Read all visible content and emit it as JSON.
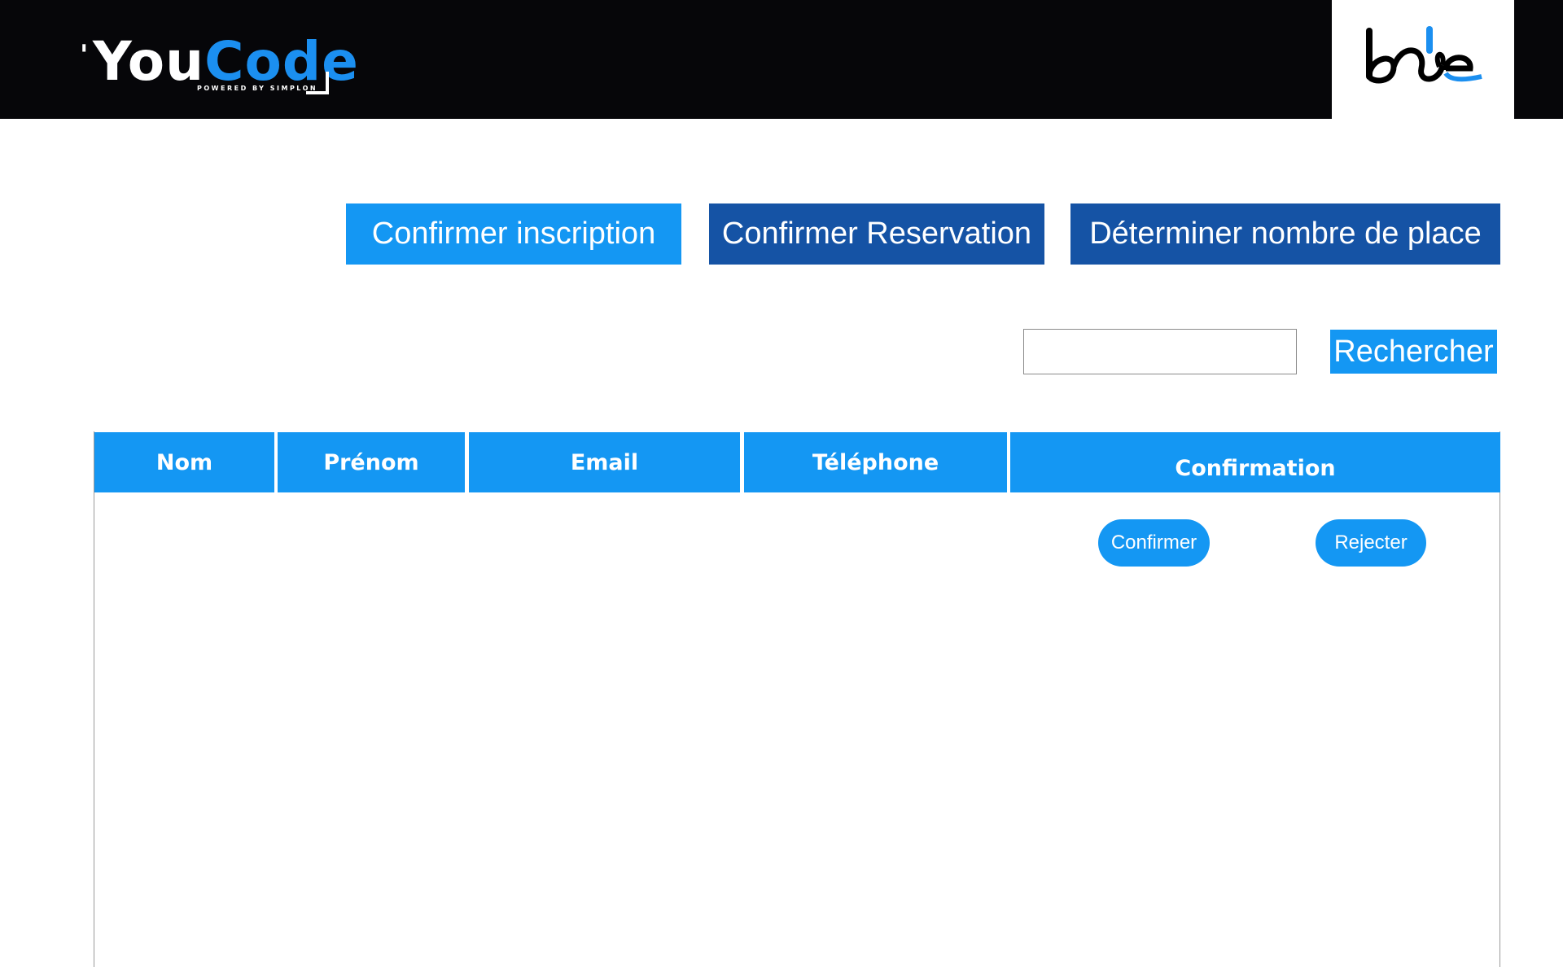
{
  "header": {
    "logo_left": {
      "you": "You",
      "code": "Code",
      "tagline": "POWERED BY SIMPLON"
    },
    "logo_right_icon": "bde-logo-icon"
  },
  "tabs": [
    {
      "label": "Confirmer inscription",
      "active": true
    },
    {
      "label": "Confirmer Reservation",
      "active": false
    },
    {
      "label": "Déterminer nombre de place",
      "active": false
    }
  ],
  "search": {
    "value": "",
    "placeholder": "",
    "button_label": "Rechercher"
  },
  "table": {
    "columns": [
      "Nom",
      "Prénom",
      "Email",
      "Téléphone",
      "Confirmation"
    ],
    "rows": [
      {
        "nom": "",
        "prenom": "",
        "email": "",
        "telephone": "",
        "confirm_label": "Confirmer",
        "reject_label": "Rejecter"
      }
    ]
  },
  "colors": {
    "header_bg": "#060609",
    "accent_light": "#1497f3",
    "accent_dark": "#1553a5",
    "code_blue": "#1b8ff0"
  }
}
